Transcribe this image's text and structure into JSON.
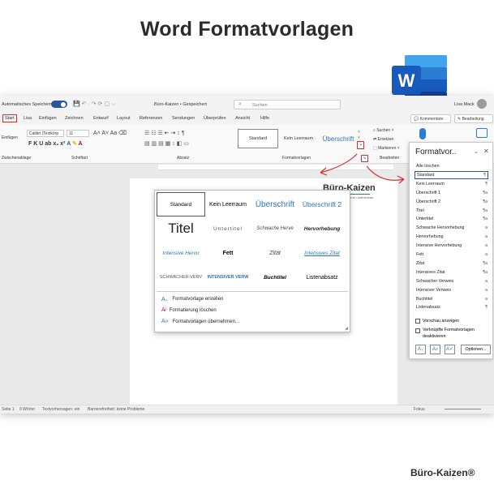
{
  "heading": "Word Formatvorlagen",
  "window": {
    "autosave": "Automatisches Speichern",
    "doc_title": "Büro-Kaizen • Gespeichert",
    "search_placeholder": "Suchen",
    "user": "Lisa Mack"
  },
  "menu": [
    "Start",
    "Lisa",
    "Einfügen",
    "Zeichnen",
    "Entwurf",
    "Layout",
    "Referenzen",
    "Sendungen",
    "Überprüfen",
    "Ansicht",
    "Hilfe"
  ],
  "menu_right": {
    "comments": "Kommentare",
    "editing": "Bearbeitung"
  },
  "ribbon": {
    "font": "Calibri (Textkörp",
    "size": "11",
    "groups": {
      "clipboard": "Zwischenablage",
      "font": "Schriftart",
      "paragraph": "Absatz",
      "styles": "Formatvorlagen",
      "edit": "Bearbeiten"
    },
    "styles": [
      "Standard",
      "Kein Leerraum",
      "Überschrift"
    ],
    "edit": {
      "search": "Suchen",
      "replace": "Ersetzen",
      "select": "Markieren"
    },
    "left_words": [
      "Einfügen"
    ]
  },
  "gallery": {
    "rows": [
      [
        "Standard",
        "Kein Leerraum",
        "Überschrift",
        "Überschrift 2"
      ],
      [
        "Titel",
        "Untertitel",
        "Schwache Herve",
        "Hervorhebung"
      ],
      [
        "Intensive Hervo",
        "Fett",
        "Zitat",
        "Intensives Zitat"
      ],
      [
        "Schwacher Verv",
        "Intensiver Verw",
        "Buchtitel",
        "Listenabsatz"
      ]
    ],
    "actions": [
      "Formatvorlage erstellen",
      "Formatierung löschen",
      "Formatvorlagen übernehmen..."
    ]
  },
  "doc_logo": {
    "name": "Büro-Kaizen",
    "tag": "anz im Unternehmen"
  },
  "pane": {
    "title": "Formatvor..",
    "items": [
      {
        "label": "Alle löschen",
        "icon": ""
      },
      {
        "label": "Standard",
        "icon": "¶"
      },
      {
        "label": "Kein Leerraum",
        "icon": "¶"
      },
      {
        "label": "Überschrift 1",
        "icon": "¶a"
      },
      {
        "label": "Überschrift 2",
        "icon": "¶a"
      },
      {
        "label": "Titel",
        "icon": "¶a"
      },
      {
        "label": "Untertitel",
        "icon": "¶a"
      },
      {
        "label": "Schwache Hervorhebung",
        "icon": "a"
      },
      {
        "label": "Hervorhebung",
        "icon": "a"
      },
      {
        "label": "Intensive Hervorhebung",
        "icon": "a"
      },
      {
        "label": "Fett",
        "icon": "a"
      },
      {
        "label": "Zitat",
        "icon": "¶a"
      },
      {
        "label": "Intensives Zitat",
        "icon": "¶a"
      },
      {
        "label": "Schwacher Verweis",
        "icon": "a"
      },
      {
        "label": "Intensiver Verweis",
        "icon": "a"
      },
      {
        "label": "Buchtitel",
        "icon": "a"
      },
      {
        "label": "Listenabsatz",
        "icon": "¶"
      }
    ],
    "preview": "Vorschau anzeigen",
    "linked": "Verknüpfte Formatvorlagen deaktivieren",
    "options": "Optionen..."
  },
  "status": {
    "page": "Seite 1",
    "words": "0 Wörter",
    "predictions": "Textvorhersagen: ein",
    "access": "Barrierefreiheit: keine Probleme",
    "focus": "Fokus"
  },
  "brand": "Büro-Kaizen®",
  "colors": {
    "accent": "#2b579a",
    "red": "#d32f2f",
    "link": "#2e74b5"
  }
}
